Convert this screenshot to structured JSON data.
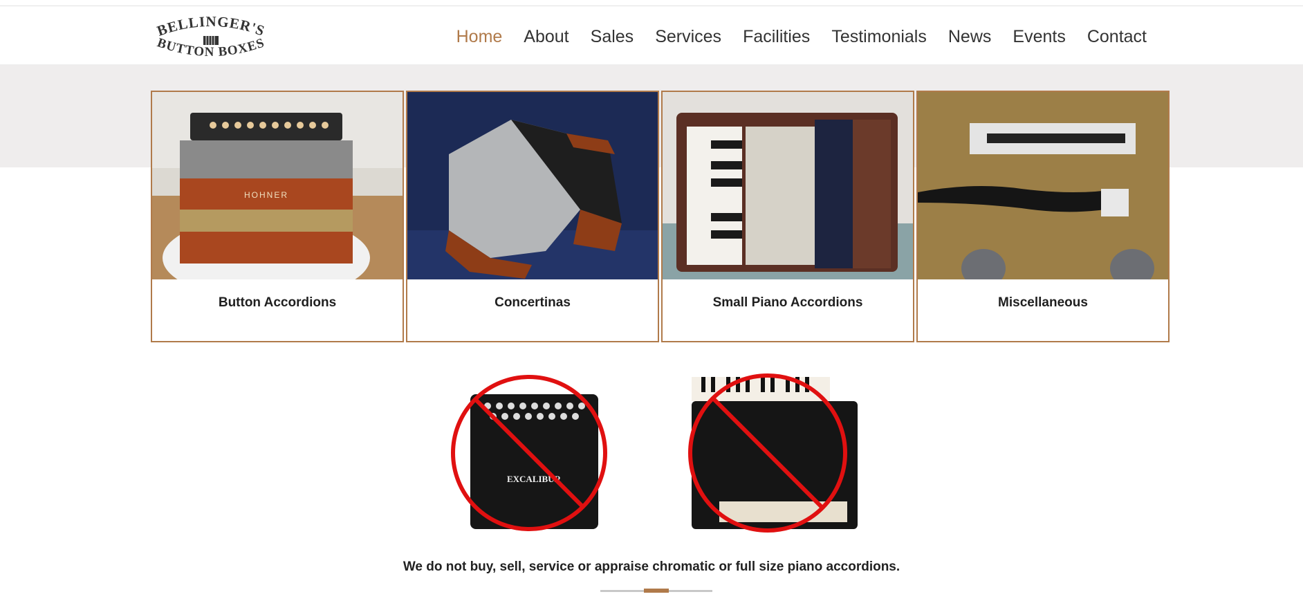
{
  "brand": {
    "line1": "BELLINGER'S",
    "line2": "BUTTON BOXES",
    "accent_color": "#b07a4a"
  },
  "nav": {
    "items": [
      "Home",
      "About",
      "Sales",
      "Services",
      "Facilities",
      "Testimonials",
      "News",
      "Events",
      "Contact"
    ],
    "active": "Home"
  },
  "categories": [
    {
      "title": "Button Accordions",
      "image_label": "HOHNER"
    },
    {
      "title": "Concertinas"
    },
    {
      "title": "Small Piano Accordions"
    },
    {
      "title": "Miscellaneous"
    }
  ],
  "exclusion": {
    "image1_label": "EXCALIBUR",
    "notice": "We do not buy, sell, service or appraise chromatic or full size piano accordions."
  },
  "slider": {
    "active_index": 1
  }
}
